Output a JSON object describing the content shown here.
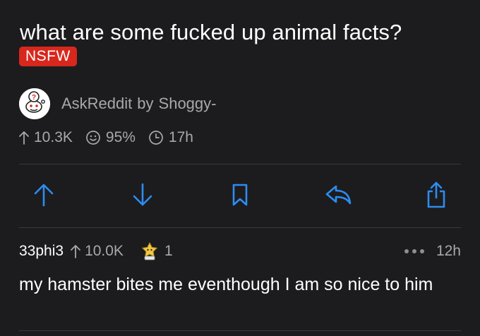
{
  "post": {
    "title": "what are some fucked up animal facts?",
    "nsfw_label": "NSFW",
    "subreddit": "AskReddit",
    "by_label": "by",
    "author": "Shoggy-",
    "score": "10.3K",
    "upvote_ratio": "95%",
    "age": "17h"
  },
  "actions": [
    "upvote-icon",
    "downvote-icon",
    "bookmark-icon",
    "reply-icon",
    "share-icon"
  ],
  "comment": {
    "user": "33phi3",
    "score": "10.0K",
    "award_count": "1",
    "age": "12h",
    "body": "my hamster bites me eventhough I am so nice to him"
  },
  "colors": {
    "background": "#1c1c1e",
    "accent_blue": "#2d8cf0",
    "nsfw_red": "#d8271d",
    "muted_text": "#a8a8ad"
  }
}
